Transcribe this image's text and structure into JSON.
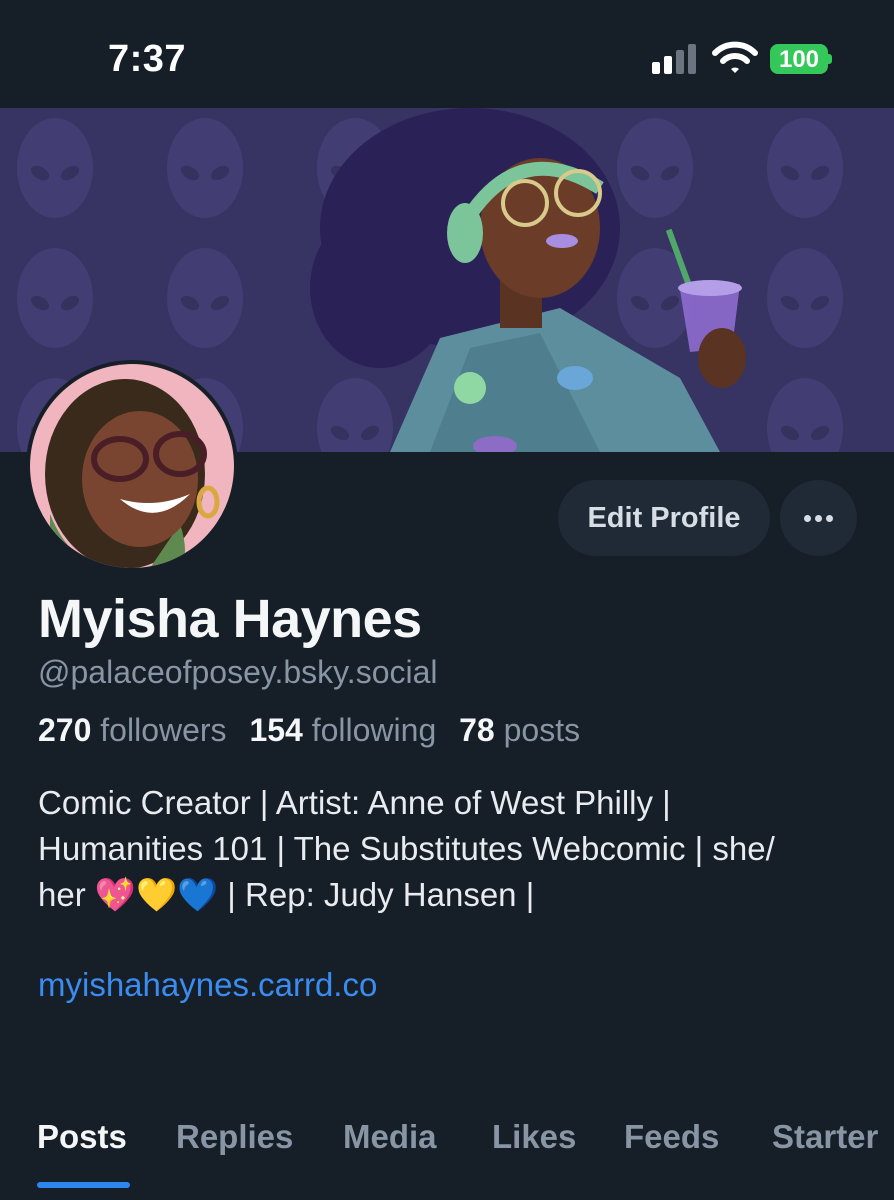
{
  "status_bar": {
    "time": "7:37",
    "battery_level": "100",
    "battery_color": "#34c759",
    "icons": [
      "cellular-signal-icon",
      "wifi-icon",
      "battery-icon"
    ]
  },
  "profile": {
    "display_name": "Myisha Haynes",
    "handle": "@palaceofposey.bsky.social",
    "stats": {
      "followers_count": "270",
      "followers_label": "followers",
      "following_count": "154",
      "following_label": "following",
      "posts_count": "78",
      "posts_label": "posts"
    },
    "bio_lines": [
      "Comic Creator | Artist: Anne of West Philly |",
      "Humanities 101 | The Substitutes Webcomic | she/",
      "her 💖💛💙 | Rep: Judy Hansen |"
    ],
    "link": "myishahaynes.carrd.co"
  },
  "actions": {
    "edit_label": "Edit Profile",
    "more_icon": "more-horizontal-icon"
  },
  "tabs": [
    {
      "label": "Posts",
      "active": true
    },
    {
      "label": "Replies",
      "active": false
    },
    {
      "label": "Media",
      "active": false
    },
    {
      "label": "Likes",
      "active": false
    },
    {
      "label": "Feeds",
      "active": false
    },
    {
      "label": "Starter",
      "active": false
    }
  ],
  "colors": {
    "background": "#161e27",
    "accent": "#2f86f0",
    "link": "#3b8cf0",
    "muted_text": "#8795a5",
    "button_bg": "#1f2a36"
  }
}
